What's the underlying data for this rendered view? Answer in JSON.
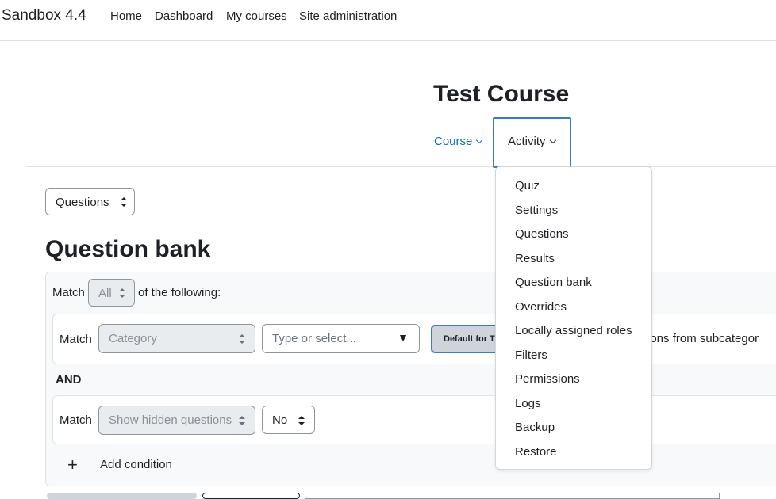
{
  "navbar": {
    "site_name": "Sandbox 4.4",
    "links": [
      "Home",
      "Dashboard",
      "My courses",
      "Site administration"
    ]
  },
  "header": {
    "course_title": "Test Course",
    "tabs": [
      "Course",
      "Activity"
    ]
  },
  "questions_select": {
    "value": "Questions"
  },
  "page_heading": "Question bank",
  "filters": {
    "match_label": "Match",
    "match_value": "All",
    "of_following": "of the following:",
    "condition1": {
      "match_label": "Match",
      "type_value": "Category",
      "input_placeholder": "Type or select...",
      "chip_label": "Default for T",
      "subcategories_text": "estions from subcategor"
    },
    "and_label": "AND",
    "condition2": {
      "match_label": "Match",
      "type_value": "Show hidden questions",
      "value": "No"
    },
    "add_icon": "plus-icon",
    "add_condition": "Add condition"
  },
  "activity_menu": {
    "items": [
      "Quiz",
      "Settings",
      "Questions",
      "Results",
      "Question bank",
      "Overrides",
      "Locally assigned roles",
      "Filters",
      "Permissions",
      "Logs",
      "Backup",
      "Restore"
    ]
  },
  "colors": {
    "link": "#0f6cbf",
    "focus_border": "#3b7ac6",
    "text": "#1d2125"
  }
}
